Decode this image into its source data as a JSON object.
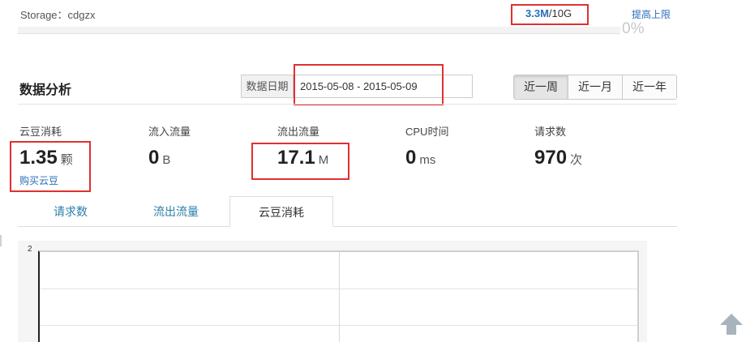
{
  "storage": {
    "label": "Storage：cdgzx",
    "used": "3.3M",
    "total": "/10G",
    "raise_label": "提高上限",
    "percent": "0%",
    "fill_fraction": 0.0
  },
  "analysis": {
    "title": "数据分析",
    "date_label": "数据日期",
    "date_value": "2015-05-08 - 2015-05-09",
    "ranges": [
      "近一周",
      "近一月",
      "近一年"
    ],
    "active_range": "近一周"
  },
  "stats": [
    {
      "label": "云豆消耗",
      "value": "1.35",
      "unit": "颗",
      "link": "购买云豆"
    },
    {
      "label": "流入流量",
      "value": "0",
      "unit": "B"
    },
    {
      "label": "流出流量",
      "value": "17.1",
      "unit": "M"
    },
    {
      "label": "CPU时间",
      "value": "0",
      "unit": "ms"
    },
    {
      "label": "请求数",
      "value": "970",
      "unit": "次"
    }
  ],
  "tabs": [
    "请求数",
    "流出流量",
    "云豆消耗"
  ],
  "active_tab": "云豆消耗",
  "chart_data": {
    "type": "line",
    "title": "",
    "y_ticks": [
      "2"
    ],
    "ylim": [
      null,
      2
    ],
    "series": [],
    "grid": true
  },
  "colors": {
    "link": "#2a6ebb",
    "tab_link": "#2a7fa8",
    "highlight": "#e03030"
  },
  "icons": {
    "back_to_top": "up-arrow-icon"
  }
}
